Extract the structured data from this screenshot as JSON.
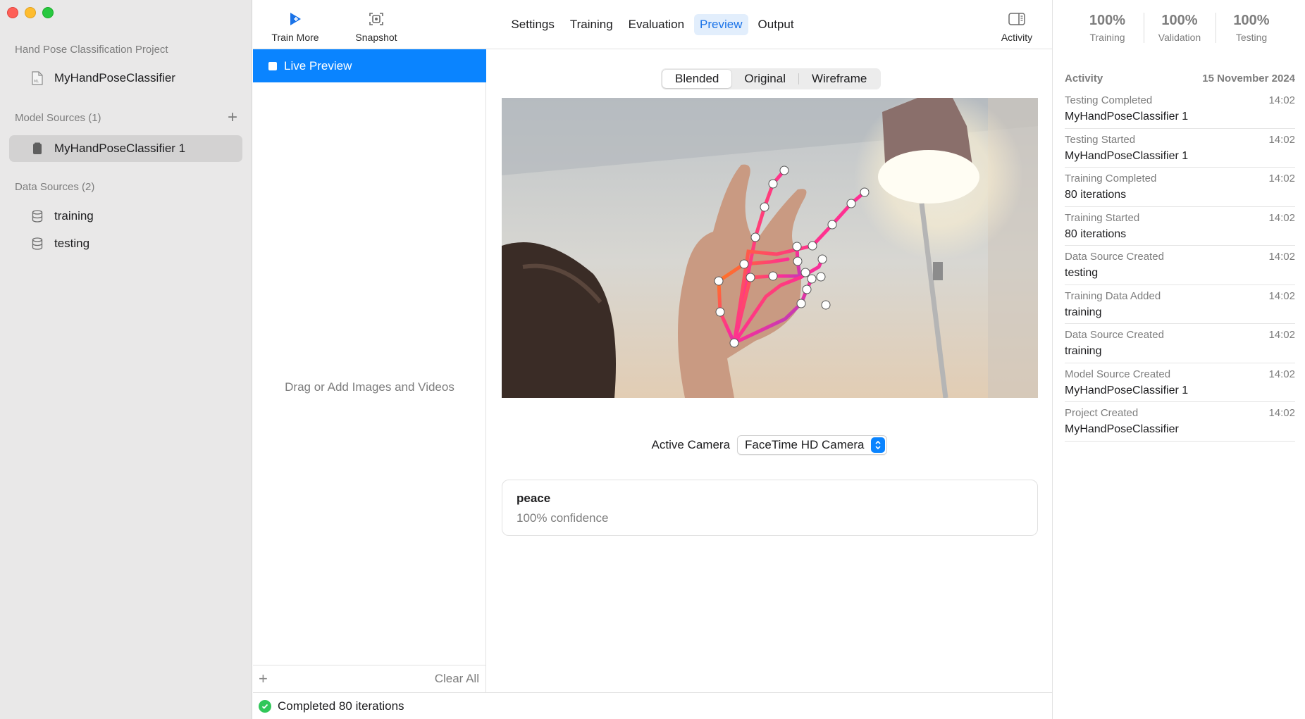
{
  "sidebar": {
    "project_title": "Hand Pose Classification Project",
    "project_file": "MyHandPoseClassifier",
    "model_sources_title": "Model Sources (1)",
    "model_source_item": "MyHandPoseClassifier 1",
    "data_sources_title": "Data Sources (2)",
    "data_sources": [
      "training",
      "testing"
    ]
  },
  "toolbar": {
    "train_more": "Train More",
    "snapshot": "Snapshot",
    "activity": "Activity",
    "tabs": [
      "Settings",
      "Training",
      "Evaluation",
      "Preview",
      "Output"
    ],
    "active_tab": "Preview"
  },
  "list": {
    "live_preview": "Live Preview",
    "drag_hint": "Drag or Add Images and Videos",
    "clear_all": "Clear All"
  },
  "preview": {
    "modes": [
      "Blended",
      "Original",
      "Wireframe"
    ],
    "active_mode": "Blended",
    "camera_label": "Active Camera",
    "camera_value": "FaceTime HD Camera",
    "prediction_label": "peace",
    "prediction_confidence": "100% confidence"
  },
  "status": {
    "message": "Completed 80 iterations"
  },
  "metrics": [
    {
      "value": "100%",
      "caption": "Training"
    },
    {
      "value": "100%",
      "caption": "Validation"
    },
    {
      "value": "100%",
      "caption": "Testing"
    }
  ],
  "activity": {
    "title": "Activity",
    "date": "15 November 2024",
    "items": [
      {
        "event": "Testing Completed",
        "time": "14:02",
        "detail": "MyHandPoseClassifier 1"
      },
      {
        "event": "Testing Started",
        "time": "14:02",
        "detail": "MyHandPoseClassifier 1"
      },
      {
        "event": "Training Completed",
        "time": "14:02",
        "detail": "80 iterations"
      },
      {
        "event": "Training Started",
        "time": "14:02",
        "detail": "80 iterations"
      },
      {
        "event": "Data Source Created",
        "time": "14:02",
        "detail": "testing"
      },
      {
        "event": "Training Data Added",
        "time": "14:02",
        "detail": "training"
      },
      {
        "event": "Data Source Created",
        "time": "14:02",
        "detail": "training"
      },
      {
        "event": "Model Source Created",
        "time": "14:02",
        "detail": "MyHandPoseClassifier 1"
      },
      {
        "event": "Project Created",
        "time": "14:02",
        "detail": "MyHandPoseClassifier"
      }
    ]
  },
  "colors": {
    "accent": "#0a84ff",
    "sidebar_bg": "#e9e8e8",
    "success": "#31c759"
  }
}
